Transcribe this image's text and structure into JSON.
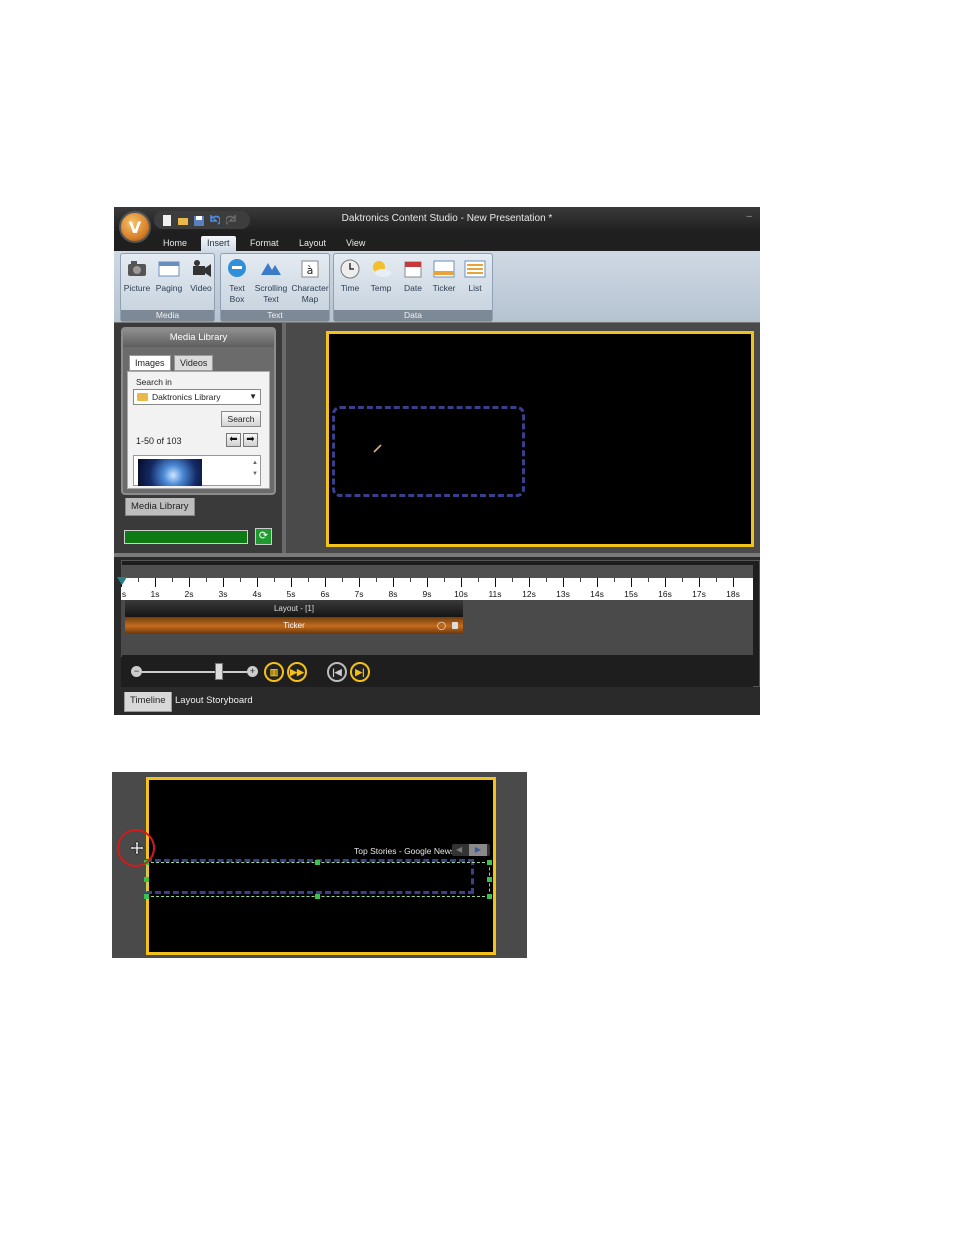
{
  "window": {
    "title": "Daktronics Content Studio - New Presentation *",
    "minimize_glyph": "–"
  },
  "ribbon_tabs": [
    {
      "label": "Home",
      "active": false
    },
    {
      "label": "Insert",
      "active": true
    },
    {
      "label": "Format",
      "active": false
    },
    {
      "label": "Layout",
      "active": false
    },
    {
      "label": "View",
      "active": false
    }
  ],
  "ribbon_groups": {
    "media": {
      "label": "Media",
      "buttons": [
        {
          "label": "Picture",
          "icon": "picture-icon"
        },
        {
          "label": "Paging",
          "icon": "paging-icon"
        },
        {
          "label": "Video",
          "icon": "video-icon"
        }
      ]
    },
    "text": {
      "label": "Text",
      "buttons": [
        {
          "label": "Text\nBox",
          "icon": "text-box-icon"
        },
        {
          "label": "Scrolling\nText",
          "icon": "scrolling-text-icon"
        },
        {
          "label": "Character\nMap",
          "icon": "character-map-icon"
        }
      ]
    },
    "data": {
      "label": "Data",
      "buttons": [
        {
          "label": "Time",
          "icon": "clock-icon",
          "dropdown": true
        },
        {
          "label": "Temp",
          "icon": "weather-icon",
          "dropdown": true
        },
        {
          "label": "Date",
          "icon": "calendar-icon",
          "dropdown": true
        },
        {
          "label": "Ticker",
          "icon": "ticker-icon"
        },
        {
          "label": "List",
          "icon": "list-icon"
        }
      ]
    }
  },
  "media_library": {
    "title": "Media Library",
    "tabs": [
      {
        "label": "Images",
        "active": true
      },
      {
        "label": "Videos",
        "active": false
      }
    ],
    "search_in_label": "Search in",
    "library_value": "Daktronics Library",
    "search_button": "Search",
    "page_count": "1-50 of 103",
    "bottom_tab": "Media Library",
    "refresh_glyph": "⟳"
  },
  "timeline": {
    "ticks": [
      "s",
      "1s",
      "2s",
      "3s",
      "4s",
      "5s",
      "6s",
      "7s",
      "8s",
      "9s",
      "10s",
      "11s",
      "12s",
      "13s",
      "14s",
      "15s",
      "16s",
      "17s",
      "18s"
    ],
    "tracks": [
      {
        "label": "Layout - [1]"
      },
      {
        "label": "Ticker"
      }
    ],
    "zoom_minus": "−",
    "zoom_plus": "+",
    "bottom_tabs": [
      {
        "label": "Timeline",
        "active": true
      },
      {
        "label": "Layout Storyboard",
        "active": false
      }
    ]
  },
  "zoomed_view": {
    "news_label": "Top Stories - Google News"
  },
  "colors": {
    "stage_border": "#f2c11a",
    "ticker_region": "#3a3f8c",
    "selection_handle": "#39c34a",
    "highlight_circle": "#d21b1b",
    "progress": "#0e7a14"
  }
}
